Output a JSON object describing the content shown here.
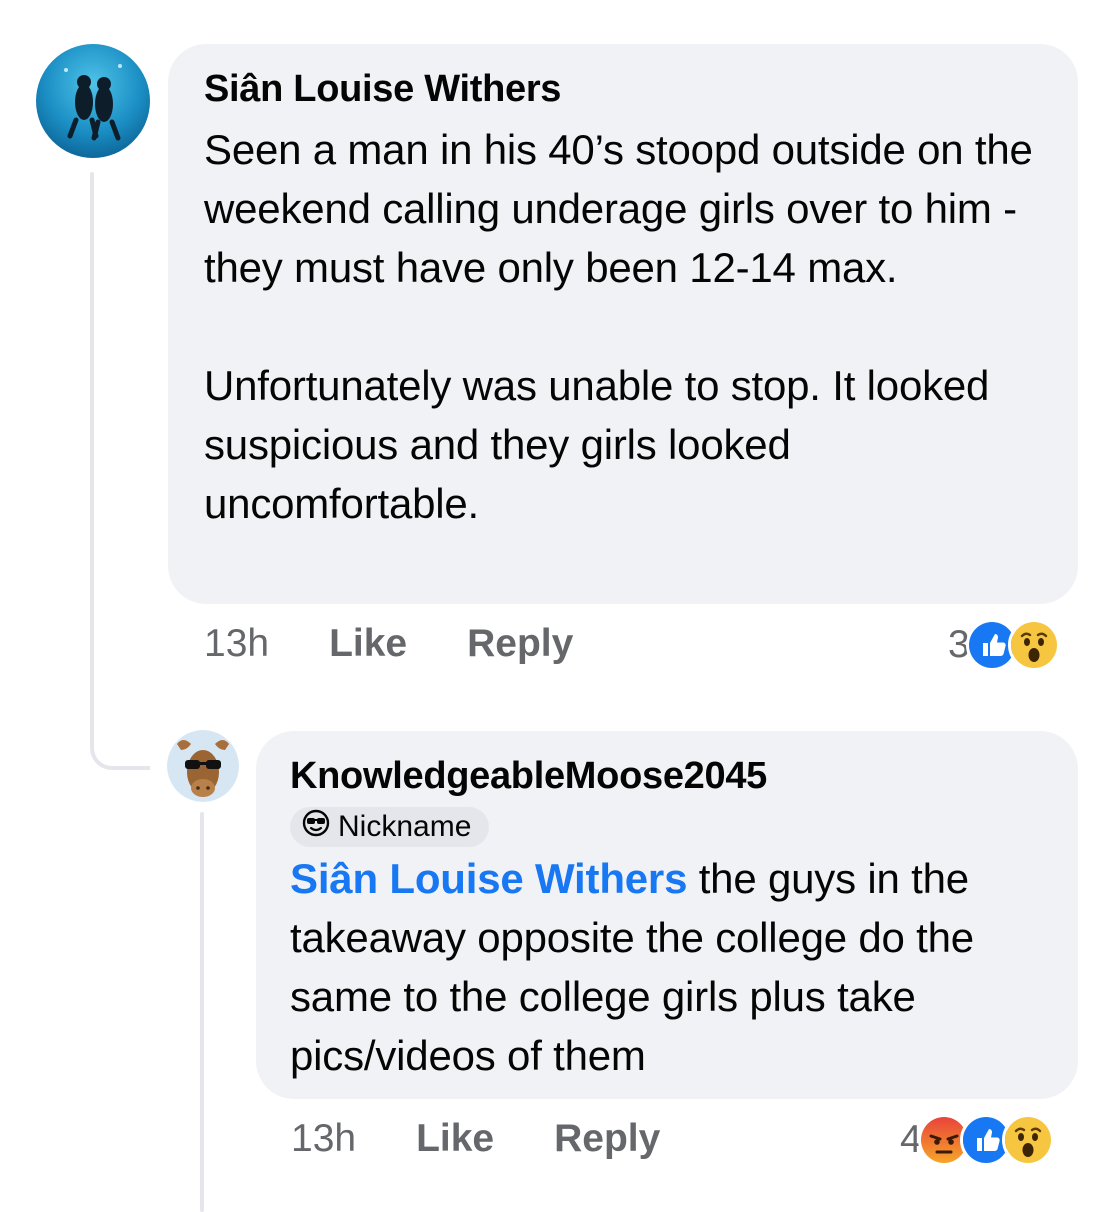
{
  "comments": [
    {
      "author": "Siân Louise Withers",
      "text": "Seen a man in his 40’s stoopd outside on the weekend calling underage girls over to him - they must have only been 12-14 max.\n\nUnfortunately was unable to stop. It looked suspicious and they girls looked uncomfortable.",
      "time": "13h",
      "like_label": "Like",
      "reply_label": "Reply",
      "reaction_count": "3",
      "reactions": [
        "like-icon",
        "wow-icon"
      ]
    },
    {
      "author": "KnowledgeableMoose2045",
      "badge_label": "Nickname",
      "badge_icon": "sunglasses-face-icon",
      "mention": "Siân Louise Withers",
      "text": " the guys in the takeaway opposite the college do the same to the college girls plus take pics/videos of them",
      "time": "13h",
      "like_label": "Like",
      "reply_label": "Reply",
      "reaction_count": "4",
      "reactions": [
        "angry-icon",
        "like-icon",
        "wow-icon"
      ]
    }
  ],
  "colors": {
    "bubble": "#f0f2f5",
    "mention": "#1877f2",
    "muted_text": "#65676b",
    "like_blue": "#1877f2",
    "wow_yellow": "#f7c641",
    "angry_red": "#e9710f"
  }
}
